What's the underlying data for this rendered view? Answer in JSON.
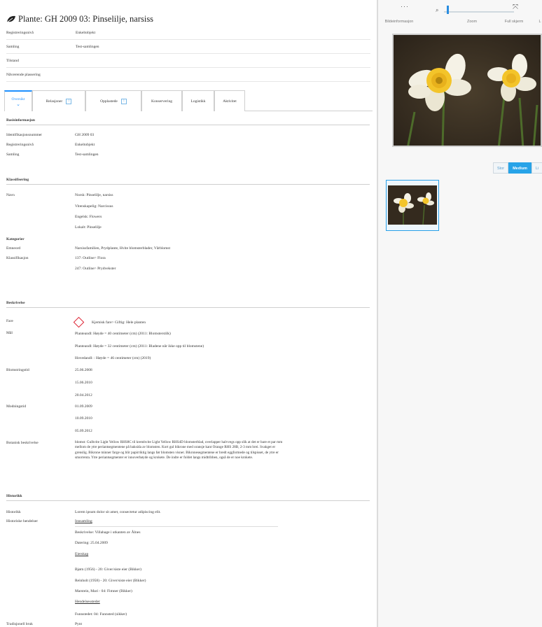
{
  "header": {
    "title": "Plante: GH 2009 03: Pinselilje, narsiss",
    "rows": [
      {
        "label": "Registreringsnivå",
        "value": "Enkeltobjekt"
      },
      {
        "label": "Samling",
        "value": "Test-samlingen"
      },
      {
        "label": "Tilstand",
        "value": ""
      },
      {
        "label": "Nåværende plassering",
        "value": ""
      }
    ]
  },
  "tabs": [
    {
      "label": "Oversikt",
      "badge": ""
    },
    {
      "label": "Relasjoner",
      "badge": "1"
    },
    {
      "label": "Opplastede",
      "badge": "1"
    },
    {
      "label": "Konservering",
      "badge": ""
    },
    {
      "label": "Logistikk",
      "badge": ""
    },
    {
      "label": "Aktivitet",
      "badge": ""
    }
  ],
  "basis": {
    "heading": "Basisinformasjon",
    "rows": [
      {
        "label": "Identifikasjonsnummer",
        "value": "GH 2009 03"
      },
      {
        "label": "Registreringsnivå",
        "value": "Enkeltobjekt"
      },
      {
        "label": "Samling",
        "value": "Test-samlingen"
      }
    ]
  },
  "klass": {
    "heading": "Klassifisering",
    "navn_label": "Navn",
    "navn_values": [
      "Norsk: Pinselilje, narsiss",
      "Vitenskapelig: Narcissus",
      "Engelsk: Flowers",
      "Lokalt: Pinselilje"
    ],
    "kategori_label": "Kategorier",
    "emneord_label": "Emneord",
    "emneord_value": "Narsissfamilien, Prydplante, Hvite blomsterblader, Vårblomst",
    "klass_label": "Klassifikasjon",
    "klass_values": [
      "137: Outline> Flora",
      "247: Outline> Prydvekster"
    ]
  },
  "beskr": {
    "heading": "Beskrivelse",
    "fare_label": "Fare",
    "fare_value": "Kjemisk fare> Giftig: Hele planten",
    "fare_icon": "hazard-diamond-icon",
    "maal_label": "Mål",
    "maal_values": [
      "Planteandl: Høyde = 40 centimeter (cm) (2011: Blomsterstilk)",
      "Planteandl: Høyde = 32 centimeter (cm) (2011: Bladene når ikke opp til blomstene)",
      "Hovedandl: : Høyde = 46 centimeter (cm) (2019)"
    ],
    "blomstring_label": "Blomstringstid",
    "blomstring_values": [
      "25.06.2008",
      "15.06.2010",
      "20.04.2012"
    ],
    "modning_label": "Modningstid",
    "modning_values": [
      "01.09.2009",
      "10.09.2010",
      "05.09.2012"
    ],
    "botanisk_label": "Botanisk beskrivelse",
    "botanisk_value": "blomst: Gulhvite Light Yellow RHS8C til kremhvite Light Yellow RHS4D blomsterblad, overlapper halvvegs opp slik at det er bare et par mm mellom de ytre periantsegmentene på baksida av blomsten. Kort gul bikrone med oransje kant Orange RHS 28B, 2-3 mm brei. Svakget er grenslig. Bikrone minner farge og blir papirriktig langs før blomsten visner. Bikronesegmentene er bredt eggformede og tilspisset, de ytre er smorrenta. Ytre periantsegmenter er innoverbøyde og krokete. De indre er foldet langs midtribben, også de er noe krokete."
  },
  "hist": {
    "heading": "Historikk",
    "hist_label": "Historikk",
    "hist_value": "Lorem ipsum dolor sit amet, consectetur adipiscing elit.",
    "hend_label": "Historiske hendelser",
    "innsamling_title": "Innsamling",
    "innsamling_desc": "Beskrivelse: Villahage i utkanten av Ålnes",
    "innsamling_date": "Datering: 25.04.2009",
    "eierskap_title": "Eierskap",
    "eierskap_values": [
      "Bjørn (1956) - 20: Giver/siste eier (Bikker)",
      "Reinholt (1958) - 20: Giver/siste eier (Bikker)",
      "Marstein, Mari - 04: Fimner (Bikker)"
    ],
    "hendelsessteder_title": "Hendelsessteder",
    "hendelsessted_value": "Funnstedet: 04: Funnsted (sikker)",
    "trad_label": "Tradisjonell bruk",
    "trad_value": "Pynt"
  },
  "viewer": {
    "toolbar": {
      "info_label": "Bildeinformasjon",
      "zoom_label": "Zoom",
      "fullscreen_label": "Full skjerm",
      "cut_label": "L"
    },
    "sizes": [
      "Stor",
      "Medium",
      "Li"
    ],
    "selected_size": "Medium",
    "zoom_fraction": 0.05
  },
  "colors": {
    "accent": "#1e90ff",
    "hazard": "#dd2233",
    "selected_size_bg": "#27a3e8"
  }
}
